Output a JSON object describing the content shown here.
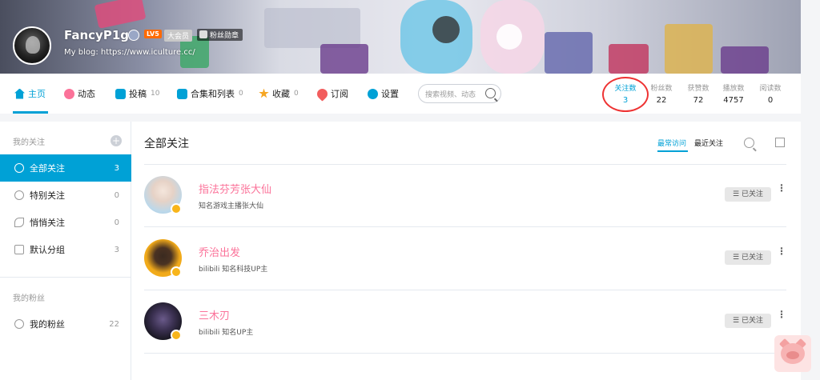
{
  "profile": {
    "username": "FancyP1g8",
    "level_badge": "LV5",
    "vip_badge": "大会员",
    "fans_badge": "粉丝勋章",
    "sign": "My blog: https://www.iculture.cc/"
  },
  "nav": {
    "items": [
      {
        "label": "主页",
        "count": "",
        "icon": "home-icon"
      },
      {
        "label": "动态",
        "count": "",
        "icon": "dynamic-icon"
      },
      {
        "label": "投稿",
        "count": "10",
        "icon": "upload-icon"
      },
      {
        "label": "合集和列表",
        "count": "0",
        "icon": "collection-icon"
      },
      {
        "label": "收藏",
        "count": "0",
        "icon": "star-icon"
      },
      {
        "label": "订阅",
        "count": "",
        "icon": "heart-icon"
      },
      {
        "label": "设置",
        "count": "",
        "icon": "gear-icon"
      }
    ],
    "search_placeholder": "搜索视频、动态"
  },
  "stats": [
    {
      "label": "关注数",
      "value": "3"
    },
    {
      "label": "粉丝数",
      "value": "22"
    },
    {
      "label": "获赞数",
      "value": "72"
    },
    {
      "label": "播放数",
      "value": "4757"
    },
    {
      "label": "阅读数",
      "value": "0"
    }
  ],
  "sidebar": {
    "follow_heading": "我的关注",
    "add_symbol": "+",
    "follow_groups": [
      {
        "label": "全部关注",
        "count": "3"
      },
      {
        "label": "特别关注",
        "count": "0"
      },
      {
        "label": "悄悄关注",
        "count": "0"
      },
      {
        "label": "默认分组",
        "count": "3"
      }
    ],
    "fans_heading": "我的粉丝",
    "fans_item": {
      "label": "我的粉丝",
      "count": "22"
    }
  },
  "main": {
    "title": "全部关注",
    "sort_recent_visit": "最常访问",
    "sort_recent_follow": "最近关注",
    "follow_button_label": "☰ 已关注",
    "users": [
      {
        "name": "指法芬芳张大仙",
        "desc": "知名游戏主播张大仙"
      },
      {
        "name": "乔治出发",
        "desc": "bilibili 知名科技UP主"
      },
      {
        "name": "三木刃",
        "desc": "bilibili 知名UP主"
      }
    ]
  },
  "colors": {
    "accent": "#00a1d6",
    "name_pink": "#fb7299",
    "highlight_circle": "#ee3333"
  }
}
